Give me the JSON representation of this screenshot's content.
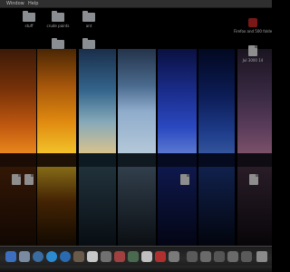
{
  "menubar": {
    "items": [
      "Window",
      "Help"
    ]
  },
  "desktop": {
    "top_row": [
      {
        "label": "stuff",
        "icon": "folder-icon"
      },
      {
        "label": "crude paints",
        "icon": "folder-icon"
      },
      {
        "label": "ant",
        "icon": "folder-icon"
      }
    ],
    "top_right": {
      "label": "Firefox and 500 folders",
      "icon": "application-icon"
    },
    "mid": [
      {
        "label": "",
        "icon": "folder-icon"
      },
      {
        "label": "",
        "icon": "folder-icon"
      }
    ],
    "side_right": {
      "label": "Jul 3000 14",
      "icon": "document-icon"
    },
    "bottom_row": [
      {
        "label": "",
        "icon": "document-icon"
      },
      {
        "label": "",
        "icon": "document-icon"
      },
      {
        "label": "",
        "icon": "document-icon"
      },
      {
        "label": "",
        "icon": "document-icon"
      }
    ]
  },
  "dock": {
    "items": [
      "finder-icon",
      "mail-icon",
      "safari-icon",
      "skype-icon",
      "itunes-icon",
      "photo-icon",
      "ical-icon",
      "system-preferences-icon",
      "app-icon",
      "app-icon",
      "app-icon",
      "app-icon",
      "folder-icon",
      "folder-icon",
      "folder-icon",
      "folder-icon",
      "folder-icon",
      "trash-icon"
    ]
  }
}
